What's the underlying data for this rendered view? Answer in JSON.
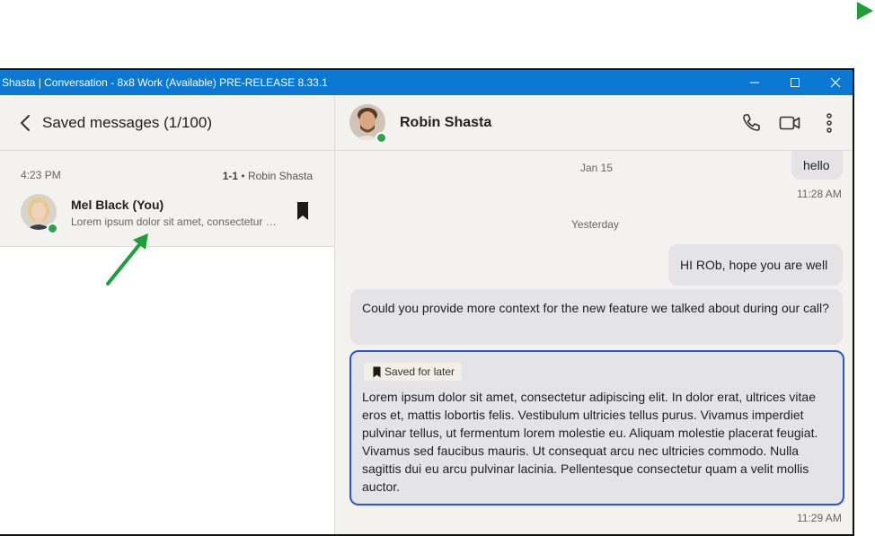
{
  "window": {
    "title": "Shasta | Conversation - 8x8 Work (Available) PRE-RELEASE 8.33.1",
    "minimize_icon": "minimize-icon",
    "maximize_icon": "maximize-icon",
    "close_icon": "close-icon"
  },
  "saved_panel": {
    "title": "Saved messages (1/100)",
    "items": [
      {
        "time": "4:23 PM",
        "thread_type": "1-1",
        "thread_with": "Robin Shasta",
        "sender": "Mel Black (You)",
        "preview": "Lorem ipsum dolor sit amet, consectetur adipiscing elit."
      }
    ]
  },
  "chat": {
    "contact_name": "Robin Shasta",
    "icons": [
      "phone-icon",
      "video-icon",
      "more-options-icon"
    ],
    "messages": [
      {
        "date_separator": "Jan 15",
        "text": "hello",
        "time": "11:28 AM"
      },
      {
        "date_separator": "Yesterday",
        "text": "HI ROb, hope you are well"
      },
      {
        "text": "Could you provide more context for the new feature we talked about during our call?"
      },
      {
        "tag": "Saved for later",
        "text": "Lorem ipsum dolor sit amet, consectetur adipiscing elit. In dolor erat, ultrices vitae eros et, mattis lobortis felis. Vestibulum ultricies tellus purus. Vivamus imperdiet pulvinar tellus, ut fermentum lorem molestie eu. Aliquam molestie placerat feugiat. Vivamus sed faucibus mauris. Ut consequat arcu nec ultricies commodo. Nulla sagittis dui eu arcu pulvinar lacinia. Pellentesque consectetur quam a velit mollis auctor.",
        "time": "11:29 AM"
      }
    ]
  },
  "colors": {
    "titlebar": "#0b78d4",
    "accent_border": "#2a55d4",
    "status_green": "#2fa34a",
    "annotation_arrow": "#1e9e3a"
  }
}
